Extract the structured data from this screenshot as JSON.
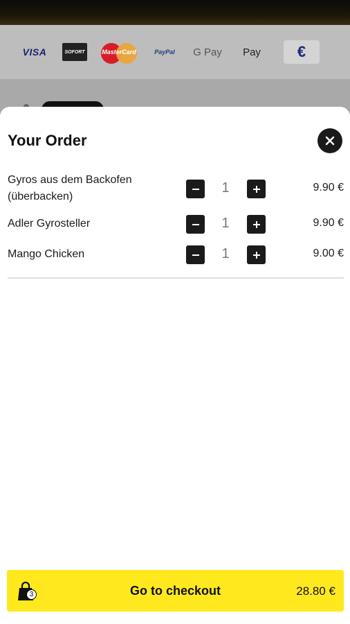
{
  "payments": {
    "visa": "VISA",
    "sofort": "SOFORT",
    "mastercard": "MasterCard",
    "paypal": "PayPal",
    "gpay": "G Pay",
    "applepay": " Pay",
    "euro": "€"
  },
  "order": {
    "title": "Your Order",
    "items": [
      {
        "name": "Gyros aus dem Backofen (überbacken)",
        "quantity": "1",
        "price": "9.90 €"
      },
      {
        "name": "Adler Gyrosteller",
        "quantity": "1",
        "price": "9.90 €"
      },
      {
        "name": "Mango Chicken",
        "quantity": "1",
        "price": "9.00 €"
      }
    ]
  },
  "checkout": {
    "label": "Go to checkout",
    "item_count": "3",
    "total": "28.80 €"
  },
  "colors": {
    "accent": "#ffe81e",
    "dark": "#1b1b1b"
  }
}
